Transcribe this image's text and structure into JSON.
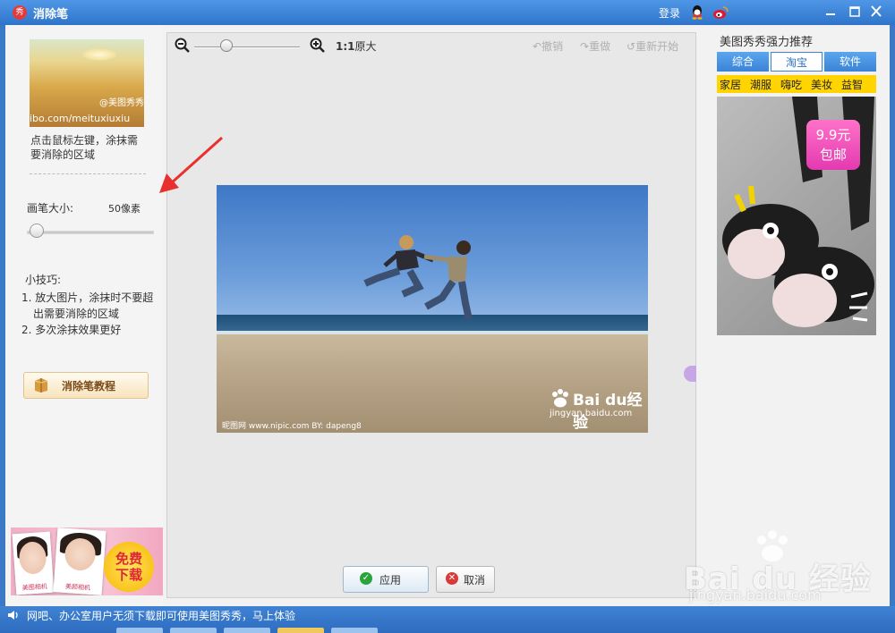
{
  "window": {
    "title": "消除笔",
    "login": "登录",
    "icons": [
      "app-logo-icon",
      "qq-icon",
      "weibo-icon",
      "minimize-icon",
      "maximize-icon",
      "close-icon"
    ]
  },
  "left_panel": {
    "thumbnail_watermark": "@美图秀秀",
    "thumbnail_url": "ibo.com/meituxiuxiu",
    "hint": "点击鼠标左键，涂抹需要消除的区域",
    "brush_size_label": "画笔大小:",
    "brush_size_value": "50像素",
    "tips_title": "小技巧:",
    "tips": [
      "1. 放大图片，涂抹时不要超",
      "出需要消除的区域",
      "2. 多次涂抹效果更好"
    ],
    "tutorial_button": "消除笔教程",
    "promo": {
      "card1": "美图相机",
      "card2": "美颜相机",
      "badge_line1": "免费",
      "badge_line2": "下载"
    }
  },
  "toolbar": {
    "actual_size_prefix": "1:1",
    "actual_size": "原大",
    "undo": "撤销",
    "redo": "重做",
    "restart": "重新开始"
  },
  "photo": {
    "watermark_brand": "Bai du经验",
    "watermark_url": "jingyan.baidu.com",
    "credit": "昵图网 www.nipic.com   BY: dapeng8"
  },
  "actions": {
    "apply": "应用",
    "cancel": "取消"
  },
  "right_panel": {
    "title": "美图秀秀强力推荐",
    "tabs": [
      {
        "label": "综合",
        "active": false
      },
      {
        "label": "淘宝",
        "active": true
      },
      {
        "label": "软件",
        "active": false
      }
    ],
    "categories": [
      "家居",
      "潮服",
      "嗨吃",
      "美妆",
      "益智"
    ],
    "ad_price": "9.9元",
    "ad_shipping": "包邮"
  },
  "statusbar": {
    "text": "网吧、办公室用户无须下载即可使用美图秀秀，马上体验"
  },
  "site_watermark": {
    "brand": "Bai du 经验",
    "url": "jingyan.baidu.com"
  },
  "colors": {
    "titlebar": "#2f74c9",
    "tab_active_text": "#2e6fc0",
    "category_bar": "#ffd400",
    "annotation_arrow": "#e8302e",
    "apply_icon": "#2aa33a",
    "cancel_icon": "#d83a3a"
  }
}
